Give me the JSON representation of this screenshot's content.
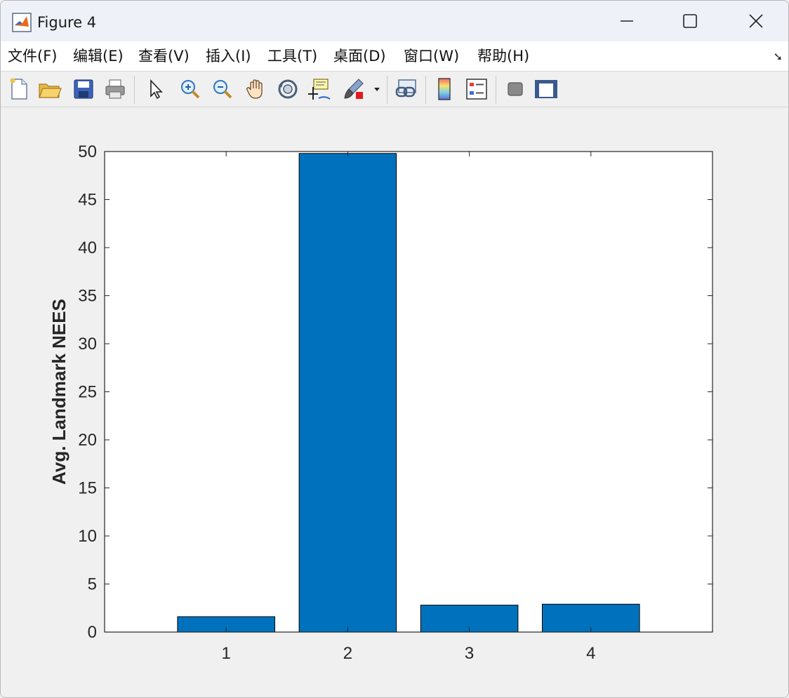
{
  "window": {
    "title": "Figure 4"
  },
  "menu": {
    "items": [
      "文件(F)",
      "编辑(E)",
      "查看(V)",
      "插入(I)",
      "工具(T)",
      "桌面(D)",
      "窗口(W)",
      "帮助(H)"
    ]
  },
  "toolbar": {
    "icons": [
      "new-figure-icon",
      "open-icon",
      "save-icon",
      "print-icon",
      "select-arrow-icon",
      "zoom-in-icon",
      "zoom-out-icon",
      "pan-hand-icon",
      "rotate-3d-icon",
      "data-cursor-icon",
      "brush-icon",
      "link-plot-icon",
      "colorbar-icon",
      "legend-icon",
      "hide-plot-tools-icon",
      "show-plot-tools-icon"
    ]
  },
  "chart_data": {
    "type": "bar",
    "categories": [
      "1",
      "2",
      "3",
      "4"
    ],
    "values": [
      1.6,
      49.8,
      2.8,
      2.9
    ],
    "title": "",
    "xlabel": "",
    "ylabel": "Avg. Landmark NEES",
    "ylim": [
      0,
      50
    ],
    "xlim": [
      0,
      5
    ],
    "yticks": [
      0,
      5,
      10,
      15,
      20,
      25,
      30,
      35,
      40,
      45,
      50
    ],
    "xticks": [
      "1",
      "2",
      "3",
      "4"
    ],
    "bar_color": "#0072bd",
    "grid": false
  }
}
